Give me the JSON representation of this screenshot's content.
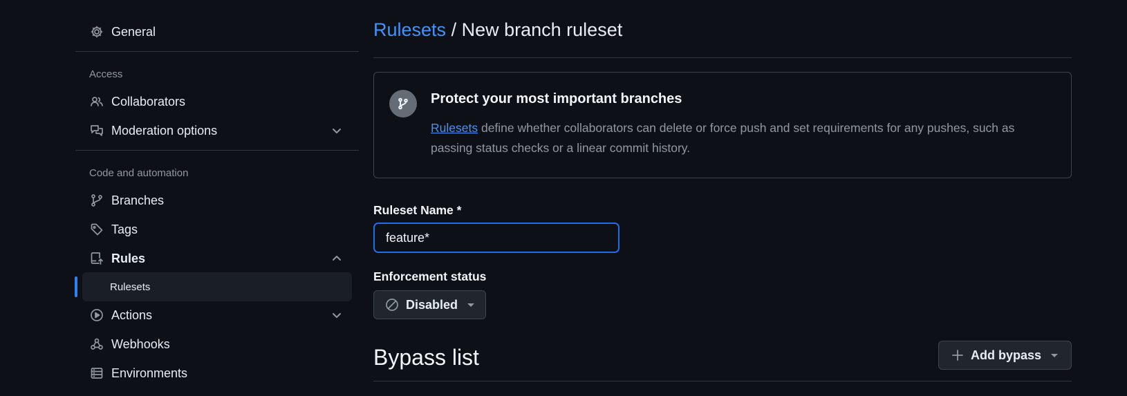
{
  "sidebar": {
    "general": "General",
    "access_heading": "Access",
    "collaborators": "Collaborators",
    "moderation": "Moderation options",
    "code_heading": "Code and automation",
    "branches": "Branches",
    "tags": "Tags",
    "rules": "Rules",
    "rulesets": "Rulesets",
    "actions": "Actions",
    "webhooks": "Webhooks",
    "environments": "Environments"
  },
  "breadcrumb": {
    "link": "Rulesets",
    "separator": "/",
    "current": "New branch ruleset"
  },
  "callout": {
    "title": "Protect your most important branches",
    "link": "Rulesets",
    "text": " define whether collaborators can delete or force push and set requirements for any pushes, such as passing status checks or a linear commit history."
  },
  "form": {
    "name_label": "Ruleset Name *",
    "name_value": "feature*",
    "enforcement_label": "Enforcement status",
    "enforcement_value": "Disabled"
  },
  "bypass": {
    "heading": "Bypass list",
    "add_button": "Add bypass"
  },
  "colors": {
    "background": "#0d1117",
    "accent": "#4493f8",
    "active_indicator": "#2f81f7",
    "border": "#30363d"
  }
}
